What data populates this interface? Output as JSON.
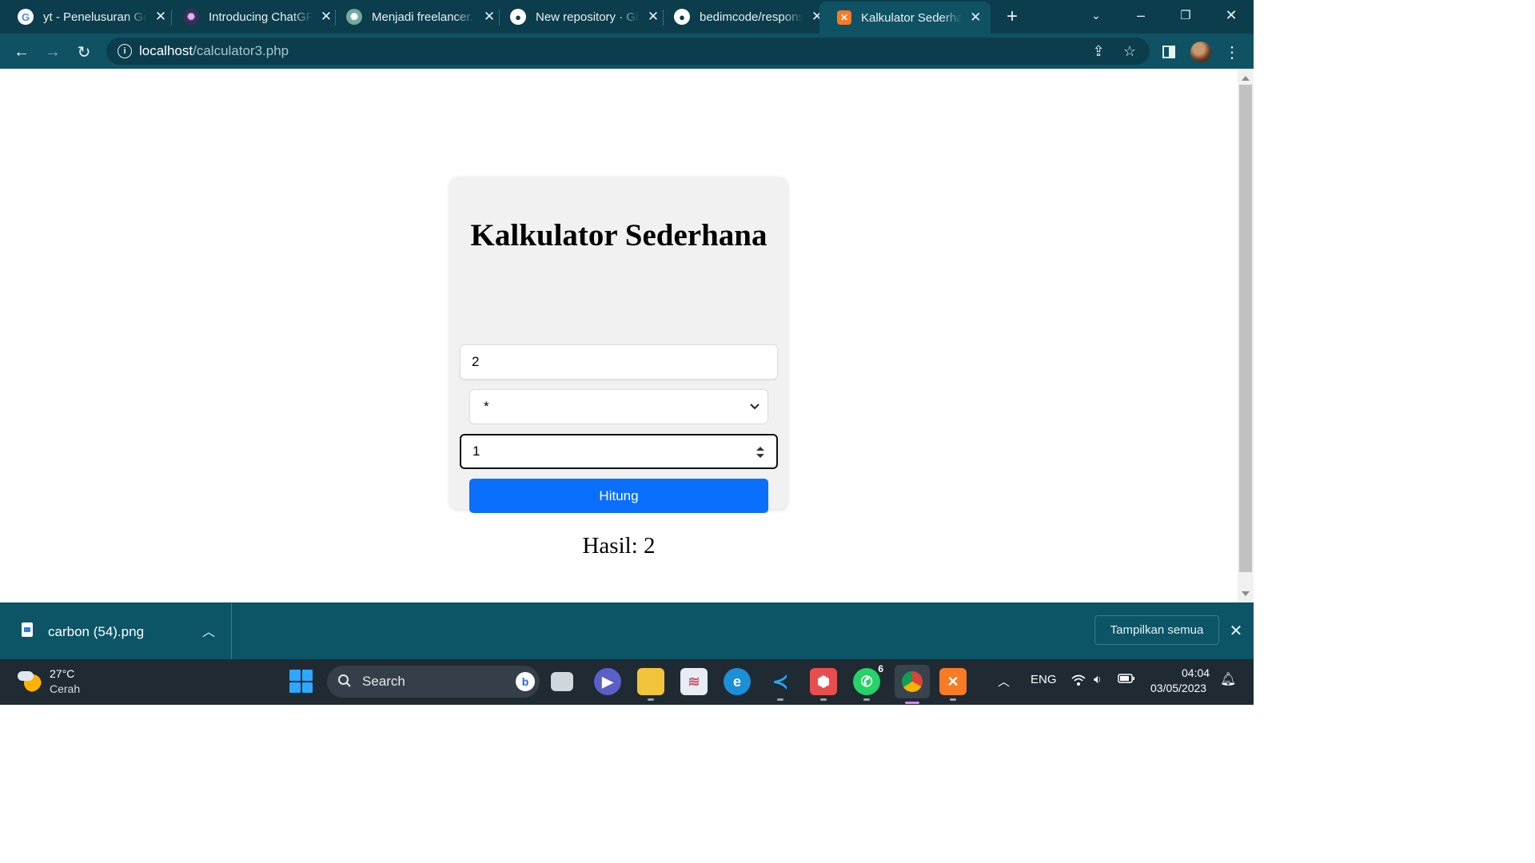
{
  "browser": {
    "tabs": [
      {
        "title": "yt - Penelusuran Google",
        "favicon": "google-icon",
        "active": false
      },
      {
        "title": "Introducing ChatGPT",
        "favicon": "openai-icon",
        "active": false
      },
      {
        "title": "Menjadi freelancer.",
        "favicon": "chatgpt-icon",
        "active": false
      },
      {
        "title": "New repository · GitHub",
        "favicon": "github-icon",
        "active": false
      },
      {
        "title": "bedimcode/responsive",
        "favicon": "github-icon",
        "active": false
      },
      {
        "title": "Kalkulator Sederhana",
        "favicon": "xampp-icon",
        "active": true
      }
    ],
    "url_host": "localhost",
    "url_path": "/calculator3.php"
  },
  "page": {
    "title": "Kalkulator Sederhana",
    "input1_value": "2",
    "operator_value": "*",
    "input2_value": "1",
    "button_label": "Hitung",
    "result_text": "Hasil: 2"
  },
  "downloads": {
    "file_name": "carbon (54).png",
    "show_all_label": "Tampilkan semua"
  },
  "taskbar": {
    "weather_temp": "27°C",
    "weather_desc": "Cerah",
    "search_label": "Search",
    "whatsapp_badge": "6",
    "language": "ENG",
    "time": "04:04",
    "date": "03/05/2023"
  },
  "colors": {
    "chrome_dark": "#0b3d4c",
    "chrome_toolbar": "#0f5264",
    "button_blue": "#0a6ffd",
    "card_bg": "#f1f1f1",
    "taskbar_bg": "#1f2a33"
  }
}
